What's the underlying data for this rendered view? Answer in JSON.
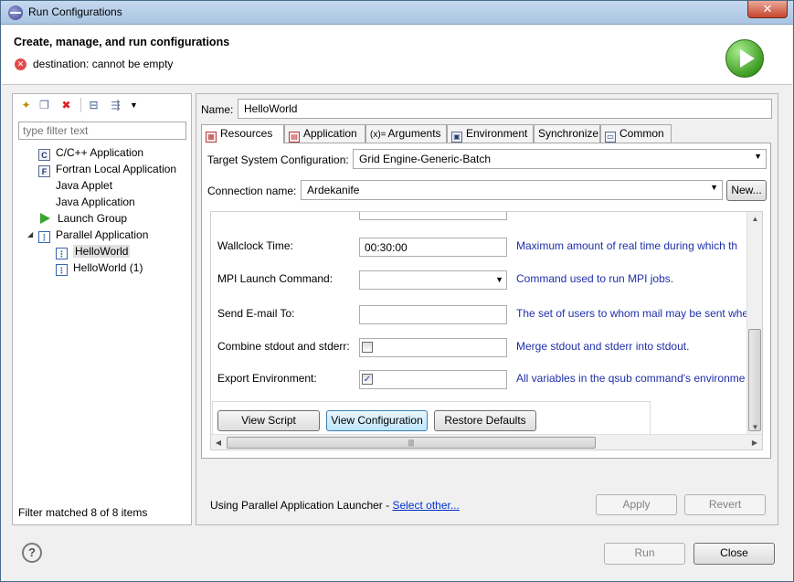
{
  "window": {
    "title": "Run Configurations",
    "close_label": "✕"
  },
  "header": {
    "title": "Create, manage, and run configurations",
    "error_message": "destination: cannot be empty"
  },
  "left_panel": {
    "toolbar_icons": [
      "new-configuration-icon",
      "duplicate-icon",
      "delete-icon",
      "collapse-all-icon",
      "filter-icon",
      "dropdown-icon"
    ],
    "filter_placeholder": "type filter text",
    "tree": [
      {
        "label": "C/C++ Application",
        "icon": "c-app-icon"
      },
      {
        "label": "Fortran Local Application",
        "icon": "fortran-app-icon"
      },
      {
        "label": "Java Applet",
        "icon": ""
      },
      {
        "label": "Java Application",
        "icon": ""
      },
      {
        "label": "Launch Group",
        "icon": "launch-group-icon"
      },
      {
        "label": "Parallel Application",
        "icon": "parallel-app-icon",
        "expanded": true
      },
      {
        "label": "HelloWorld",
        "icon": "parallel-config-icon",
        "selected": true
      },
      {
        "label": "HelloWorld (1)",
        "icon": "parallel-config-icon"
      }
    ],
    "filter_status": "Filter matched 8 of 8 items"
  },
  "right_panel": {
    "name_label": "Name:",
    "name_value": "HelloWorld",
    "tabs": [
      {
        "label": "Resources",
        "icon": "resources-icon",
        "active": true
      },
      {
        "label": "Application",
        "icon": "application-icon"
      },
      {
        "label": "Arguments",
        "icon": "arguments-icon"
      },
      {
        "label": "Environment",
        "icon": "environment-icon"
      },
      {
        "label": "Synchronize",
        "icon": ""
      },
      {
        "label": "Common",
        "icon": "common-icon"
      }
    ],
    "target_system_label": "Target System Configuration:",
    "target_system_value": "Grid Engine-Generic-Batch",
    "connection_label": "Connection name:",
    "connection_value": "Ardekanife",
    "new_button": "New...",
    "fields": [
      {
        "label": "Wallclock Time:",
        "value": "00:30:00",
        "description": "Maximum amount of real time during which th"
      },
      {
        "label": "MPI Launch Command:",
        "value": "",
        "description": "Command used to run MPI jobs."
      },
      {
        "label": "Send E-mail To:",
        "value": "",
        "description": "The set of users to whom mail may be sent whe"
      },
      {
        "label": "Combine stdout and stderr:",
        "checked": false,
        "description": "Merge stdout and stderr into stdout."
      },
      {
        "label": "Export Environment:",
        "checked": true,
        "description": "All variables in the qsub command's environme"
      }
    ],
    "action_buttons": {
      "view_script": "View Script",
      "view_configuration": "View Configuration",
      "restore_defaults": "Restore Defaults"
    },
    "launcher_text": "Using Parallel Application Launcher - ",
    "launcher_link": "Select other...",
    "apply_button": "Apply",
    "revert_button": "Revert"
  },
  "footer": {
    "help_label": "?",
    "run_button": "Run",
    "close_button": "Close"
  }
}
